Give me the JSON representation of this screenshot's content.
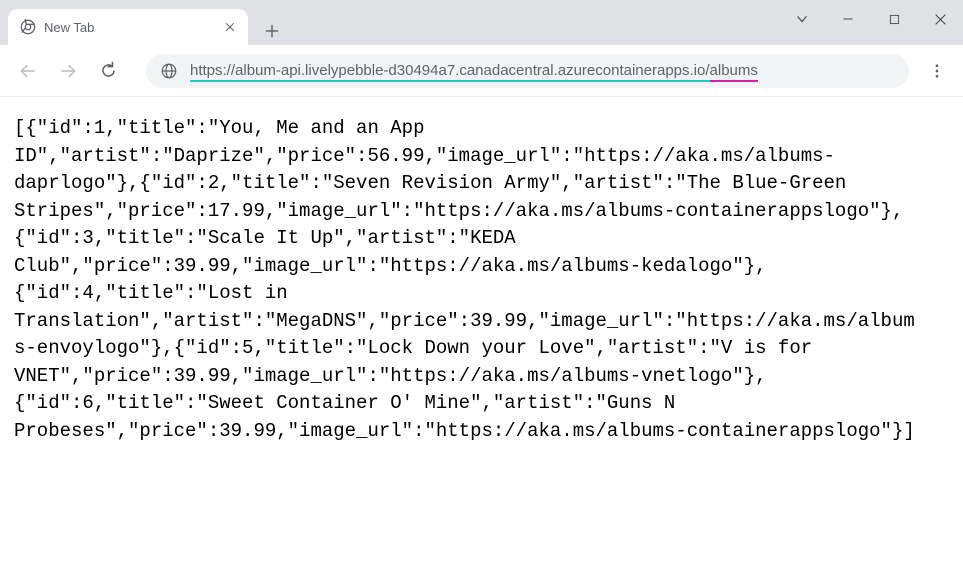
{
  "window": {
    "tab_title": "New Tab"
  },
  "toolbar": {
    "url_segment_main": "https://album-api.livelypebble-d30494a7.canadacentral.azurecontainerapps.io/",
    "url_segment_path": "albums"
  },
  "body": {
    "raw_json": "[{\"id\":1,\"title\":\"You, Me and an App ID\",\"artist\":\"Daprize\",\"price\":56.99,\"image_url\":\"https://aka.ms/albums-daprlogo\"},{\"id\":2,\"title\":\"Seven Revision Army\",\"artist\":\"The Blue-Green Stripes\",\"price\":17.99,\"image_url\":\"https://aka.ms/albums-containerappslogo\"},{\"id\":3,\"title\":\"Scale It Up\",\"artist\":\"KEDA Club\",\"price\":39.99,\"image_url\":\"https://aka.ms/albums-kedalogo\"},{\"id\":4,\"title\":\"Lost in Translation\",\"artist\":\"MegaDNS\",\"price\":39.99,\"image_url\":\"https://aka.ms/albums-envoylogo\"},{\"id\":5,\"title\":\"Lock Down your Love\",\"artist\":\"V is for VNET\",\"price\":39.99,\"image_url\":\"https://aka.ms/albums-vnetlogo\"},{\"id\":6,\"title\":\"Sweet Container O' Mine\",\"artist\":\"Guns N Probeses\",\"price\":39.99,\"image_url\":\"https://aka.ms/albums-containerappslogo\"}]"
  },
  "albums": [
    {
      "id": 1,
      "title": "You, Me and an App ID",
      "artist": "Daprize",
      "price": 56.99,
      "image_url": "https://aka.ms/albums-daprlogo"
    },
    {
      "id": 2,
      "title": "Seven Revision Army",
      "artist": "The Blue-Green Stripes",
      "price": 17.99,
      "image_url": "https://aka.ms/albums-containerappslogo"
    },
    {
      "id": 3,
      "title": "Scale It Up",
      "artist": "KEDA Club",
      "price": 39.99,
      "image_url": "https://aka.ms/albums-kedalogo"
    },
    {
      "id": 4,
      "title": "Lost in Translation",
      "artist": "MegaDNS",
      "price": 39.99,
      "image_url": "https://aka.ms/albums-envoylogo"
    },
    {
      "id": 5,
      "title": "Lock Down your Love",
      "artist": "V is for VNET",
      "price": 39.99,
      "image_url": "https://aka.ms/albums-vnetlogo"
    },
    {
      "id": 6,
      "title": "Sweet Container O' Mine",
      "artist": "Guns N Probeses",
      "price": 39.99,
      "image_url": "https://aka.ms/albums-containerappslogo"
    }
  ]
}
